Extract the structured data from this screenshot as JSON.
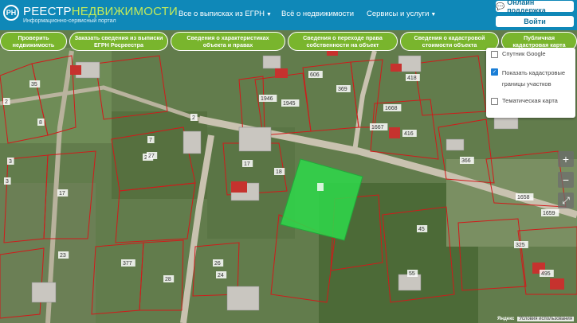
{
  "header": {
    "brand_main": "РЕЕСТР",
    "brand_accent": "НЕДВИЖИМОСТИ",
    "tagline": "Информационно-сервисный портал",
    "nav": [
      {
        "label": "Все о выписках из ЕГРН",
        "has_dropdown": true
      },
      {
        "label": "Всё о недвижимости",
        "has_dropdown": false
      },
      {
        "label": "Сервисы и услуги",
        "has_dropdown": true
      }
    ],
    "support_button": "Онлайн поддержка",
    "login_button": "Войти"
  },
  "services": [
    "Проверить недвижимость",
    "Заказать сведения из выписки ЕГРН Росреестра",
    "Сведения о характеристиках объекта и правах",
    "Сведения о переходе права собственности на объект",
    "Сведения о кадастровой стоимости объекта",
    "Публичная кадастровая карта"
  ],
  "layers": {
    "items": [
      {
        "label": "Спутник Google",
        "checked": false
      },
      {
        "label": "Показать кадастровые границы участков",
        "checked": true
      },
      {
        "label": "Тематическая карта",
        "checked": false
      }
    ]
  },
  "map_controls": {
    "zoom_in": "+",
    "zoom_out": "−",
    "fullscreen": "⤢"
  },
  "parcel_labels": [
    "35",
    "2",
    "8",
    "3",
    "29",
    "606",
    "418",
    "369",
    "1668",
    "1667",
    "416",
    "366",
    "1946",
    "1945",
    "27",
    "17",
    "18",
    "17",
    "3",
    "26",
    "24",
    "28",
    "377",
    "23",
    "325",
    "495",
    "55",
    "45",
    "1658",
    "1659",
    "7",
    "2"
  ],
  "footer": {
    "provider": "Яндекс",
    "terms": "Условия использования"
  },
  "colors": {
    "header_bg": "#0f88b8",
    "pill_bg": "#79b52d",
    "highlight_parcel": "#2fd64a",
    "parcel_border": "#d11a1a"
  }
}
